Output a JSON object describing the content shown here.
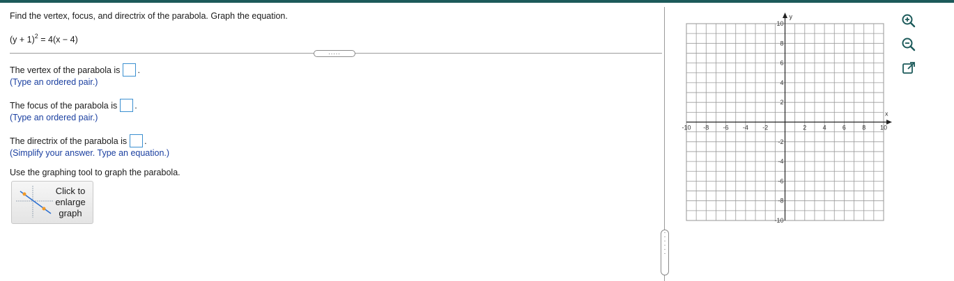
{
  "question": {
    "prompt": "Find the vertex, focus, and directrix of the parabola. Graph the equation.",
    "equation_left": "(y + 1)",
    "equation_exponent": "2",
    "equation_right": " = 4(x − 4)"
  },
  "parts": [
    {
      "label": "The vertex of the parabola is",
      "hint": "(Type an ordered pair.)"
    },
    {
      "label": "The focus of the parabola is",
      "hint": "(Type an ordered pair.)"
    },
    {
      "label": "The directrix of the parabola is",
      "hint": "(Simplify your answer. Type an equation.)"
    }
  ],
  "graph_instruction": "Use the graphing tool to graph the parabola.",
  "enlarge_button": {
    "line1": "Click to",
    "line2": "enlarge",
    "line3": "graph"
  },
  "graph": {
    "x_label": "x",
    "y_label": "y",
    "x_range": [
      -10,
      10
    ],
    "y_range": [
      -10,
      10
    ],
    "x_ticks": [
      "-10",
      "-8",
      "-6",
      "-4",
      "-2",
      "2",
      "4",
      "6",
      "8",
      "10"
    ],
    "y_ticks": [
      "10",
      "8",
      "6",
      "4",
      "2",
      "-2",
      "-4",
      "-6",
      "-8",
      "-10"
    ]
  },
  "tools": [
    "zoom-in-icon",
    "zoom-out-icon",
    "open-external-icon"
  ],
  "colors": {
    "accent": "#1c5a5a",
    "input_border": "#3a8fd0",
    "hint": "#1a3fa0"
  }
}
